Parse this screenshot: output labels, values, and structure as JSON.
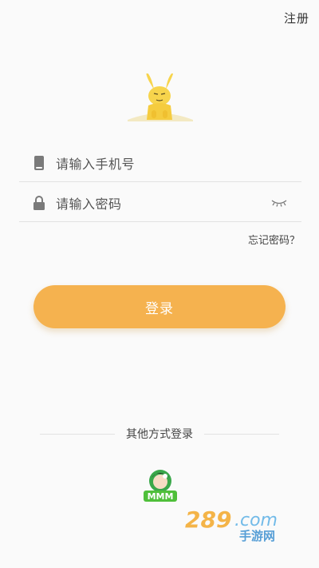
{
  "header": {
    "register_label": "注册"
  },
  "login": {
    "phone_placeholder": "请输入手机号",
    "password_placeholder": "请输入密码",
    "forgot_label": "忘记密码？",
    "submit_label": "登录"
  },
  "other_login": {
    "title": "其他方式登录",
    "providers": [
      {
        "icon": "mmm-logo-icon",
        "text": "MMM"
      }
    ]
  },
  "watermark": {
    "text": "289.com 手游网"
  },
  "colors": {
    "accent": "#f5b24f",
    "mascot": "#f7d44c",
    "background": "#fafafa"
  }
}
